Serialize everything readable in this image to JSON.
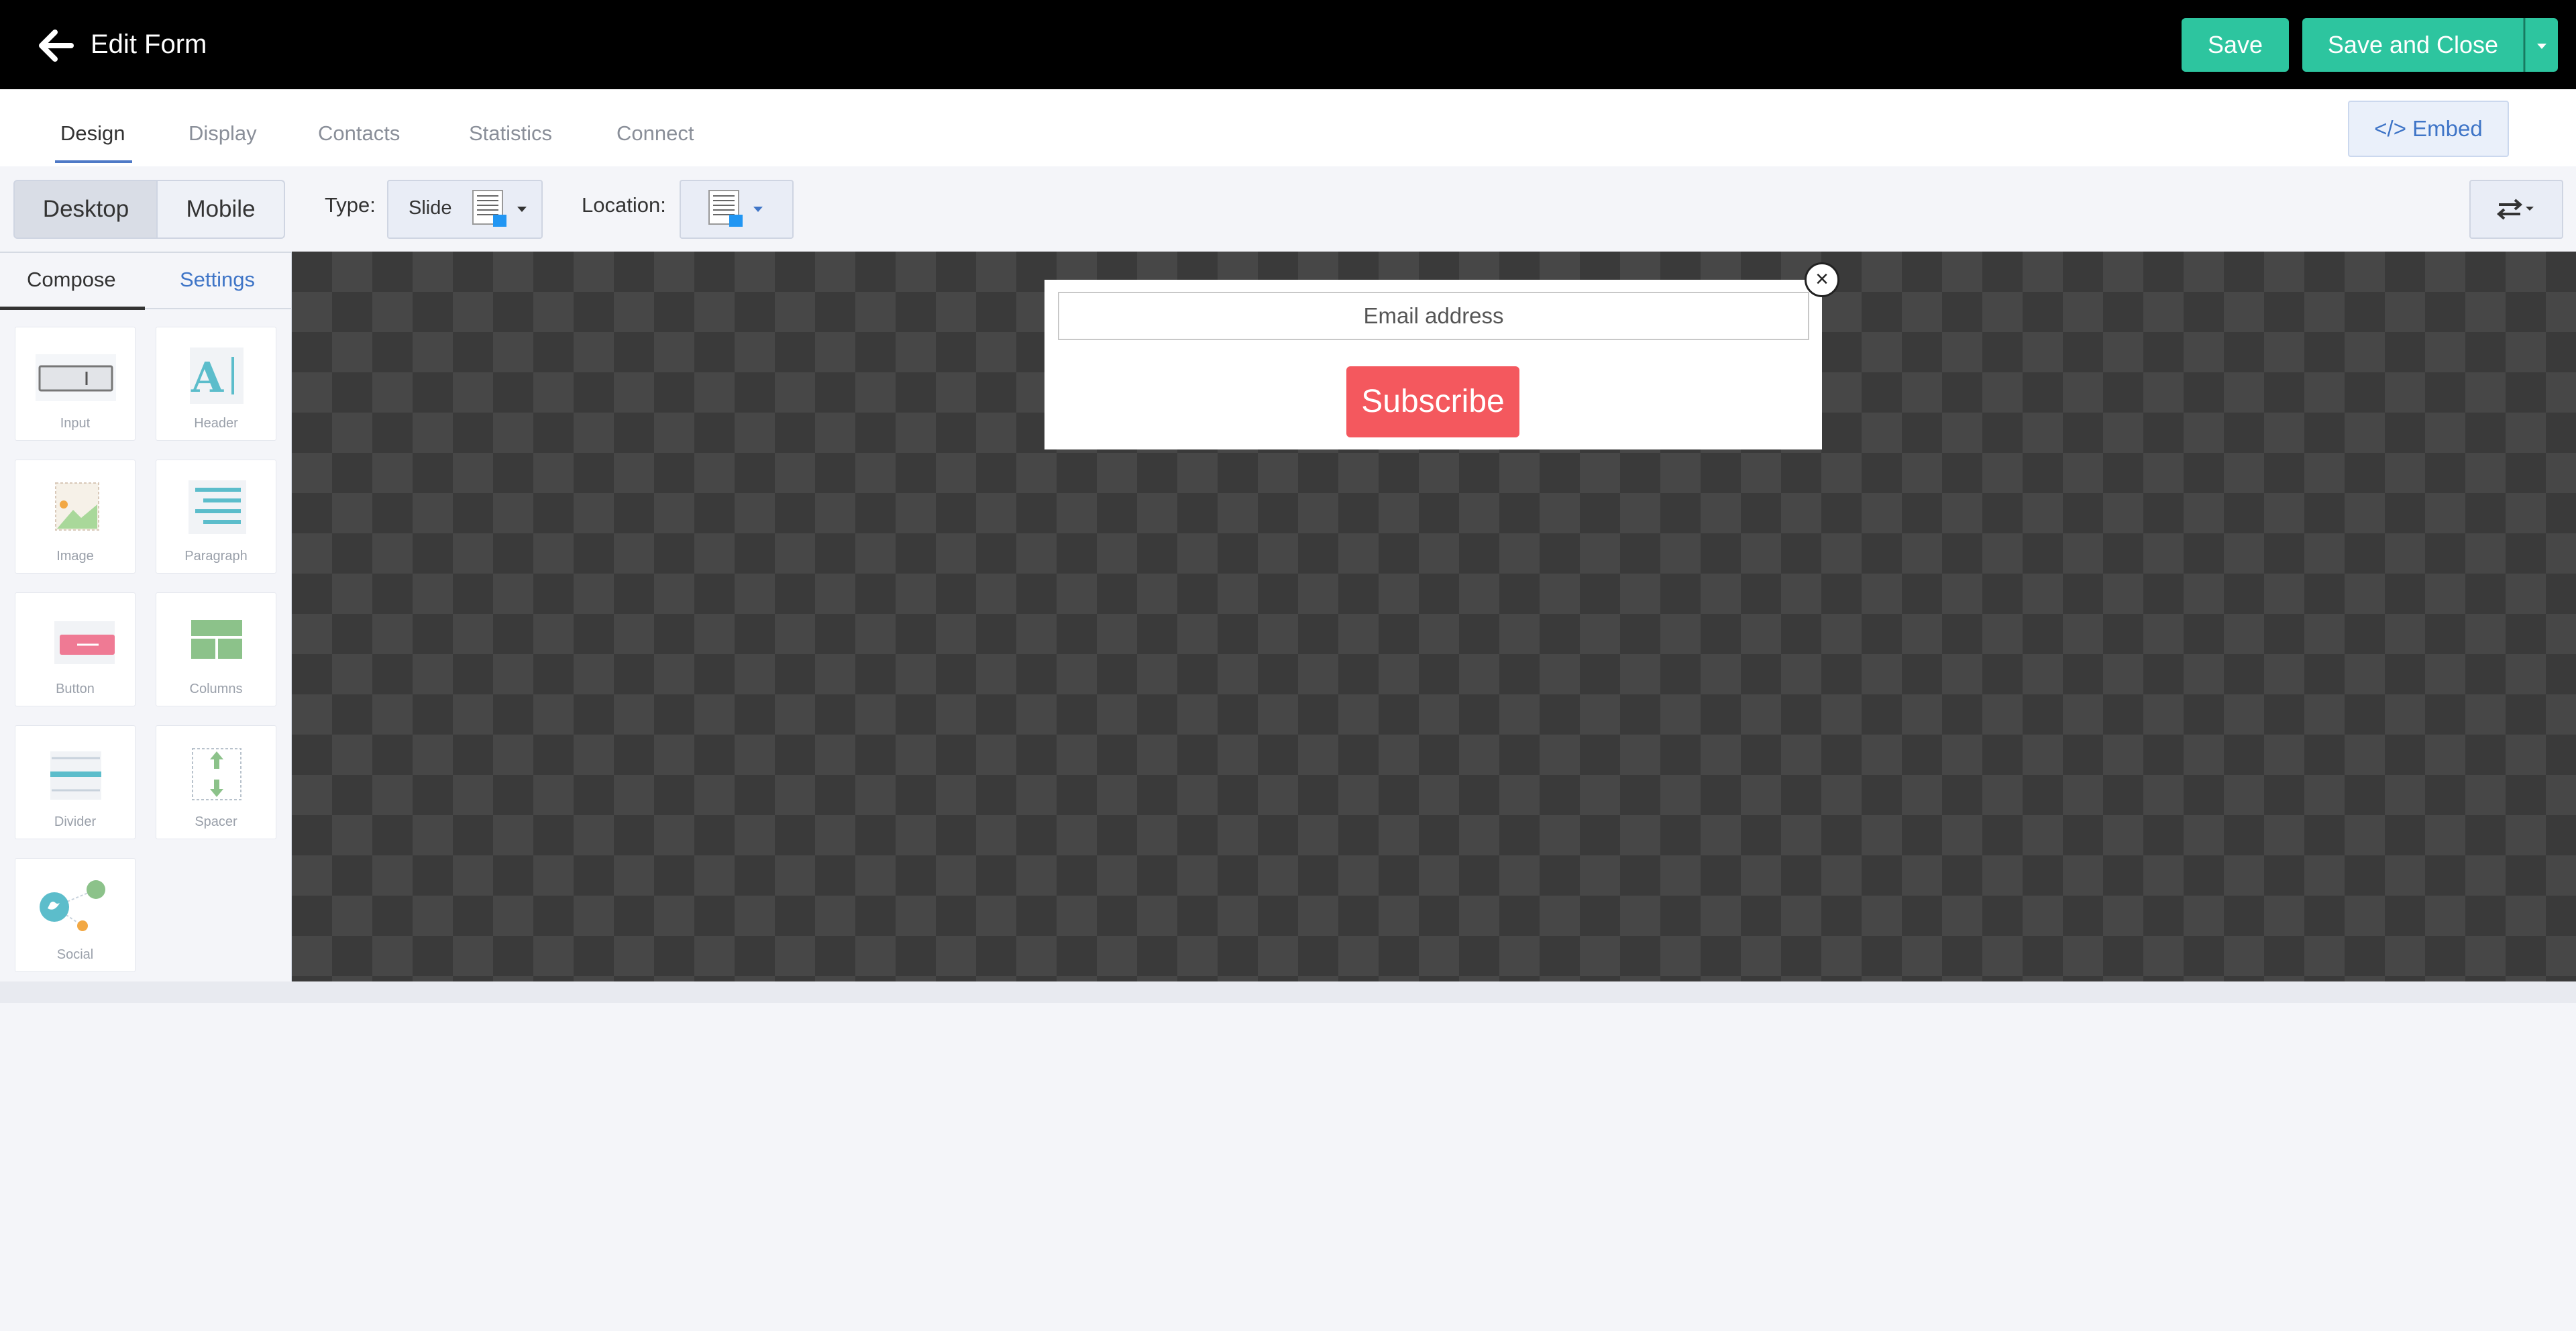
{
  "header": {
    "title": "Edit Form",
    "back_icon": "arrow-left-icon",
    "save_label": "Save",
    "save_close_label": "Save and Close",
    "accent_color": "#2dc59f"
  },
  "tabs": [
    {
      "label": "Design",
      "active": true
    },
    {
      "label": "Display"
    },
    {
      "label": "Contacts"
    },
    {
      "label": "Statistics"
    },
    {
      "label": "Connect"
    }
  ],
  "embed": {
    "label": "Embed",
    "icon": "code-icon"
  },
  "toolbar": {
    "desktop_label": "Desktop",
    "mobile_label": "Mobile",
    "type_label": "Type:",
    "type_value": "Slide",
    "location_label": "Location:"
  },
  "panel": {
    "compose_label": "Compose",
    "settings_label": "Settings",
    "blocks": [
      {
        "label": "Input",
        "icon": "input-icon"
      },
      {
        "label": "Header",
        "icon": "header-icon"
      },
      {
        "label": "Image",
        "icon": "image-icon"
      },
      {
        "label": "Paragraph",
        "icon": "paragraph-icon"
      },
      {
        "label": "Button",
        "icon": "button-icon"
      },
      {
        "label": "Columns",
        "icon": "columns-icon"
      },
      {
        "label": "Divider",
        "icon": "divider-icon"
      },
      {
        "label": "Spacer",
        "icon": "spacer-icon"
      },
      {
        "label": "Social",
        "icon": "social-icon"
      }
    ]
  },
  "form": {
    "email_placeholder": "Email address",
    "subscribe_label": "Subscribe",
    "subscribe_color": "#f4585e"
  }
}
